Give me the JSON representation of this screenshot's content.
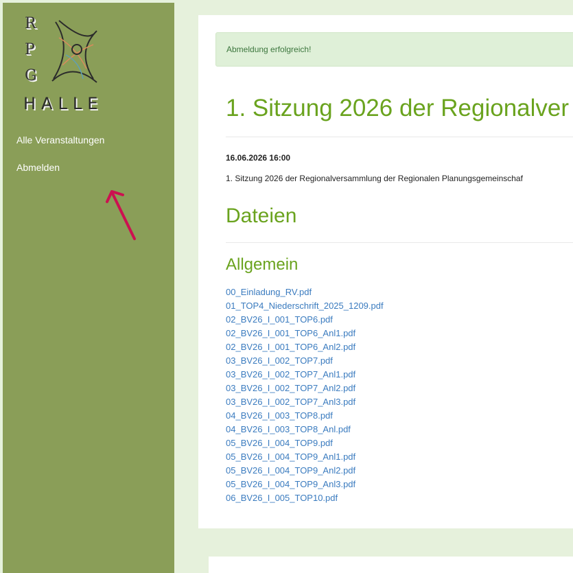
{
  "sidebar": {
    "logo": {
      "letters": [
        "R",
        "P",
        "G"
      ],
      "city": "HALLE"
    },
    "nav": [
      {
        "label": "Alle Veranstaltungen"
      },
      {
        "label": "Abmelden"
      }
    ],
    "annotation_arrow_color": "#cc1150"
  },
  "alert": {
    "text": "Abmeldung erfolgreich!"
  },
  "event": {
    "title": "1. Sitzung 2026 der Regionalver",
    "datetime": "16.06.2026 16:00",
    "description": "1. Sitzung 2026 der Regionalversammlung der Regionalen Planungsgemeinschaf"
  },
  "files_section": {
    "heading": "Dateien",
    "group_heading": "Allgemein",
    "files": [
      "00_Einladung_RV.pdf",
      "01_TOP4_Niederschrift_2025_1209.pdf",
      "02_BV26_I_001_TOP6.pdf",
      "02_BV26_I_001_TOP6_Anl1.pdf",
      "02_BV26_I_001_TOP6_Anl2.pdf",
      "03_BV26_I_002_TOP7.pdf",
      "03_BV26_I_002_TOP7_Anl1.pdf",
      "03_BV26_I_002_TOP7_Anl2.pdf",
      "03_BV26_I_002_TOP7_Anl3.pdf",
      "04_BV26_I_003_TOP8.pdf",
      "04_BV26_I_003_TOP8_Anl.pdf",
      "05_BV26_I_004_TOP9.pdf",
      "05_BV26_I_004_TOP9_Anl1.pdf",
      "05_BV26_I_004_TOP9_Anl2.pdf",
      "05_BV26_I_004_TOP9_Anl3.pdf",
      "06_BV26_I_005_TOP10.pdf"
    ]
  },
  "colors": {
    "sidebar_bg": "#8a9e58",
    "heading_green": "#6aa31e",
    "link_blue": "#3a7bbf",
    "page_bg": "#e6f1dc",
    "alert_bg": "#dff0d8"
  }
}
